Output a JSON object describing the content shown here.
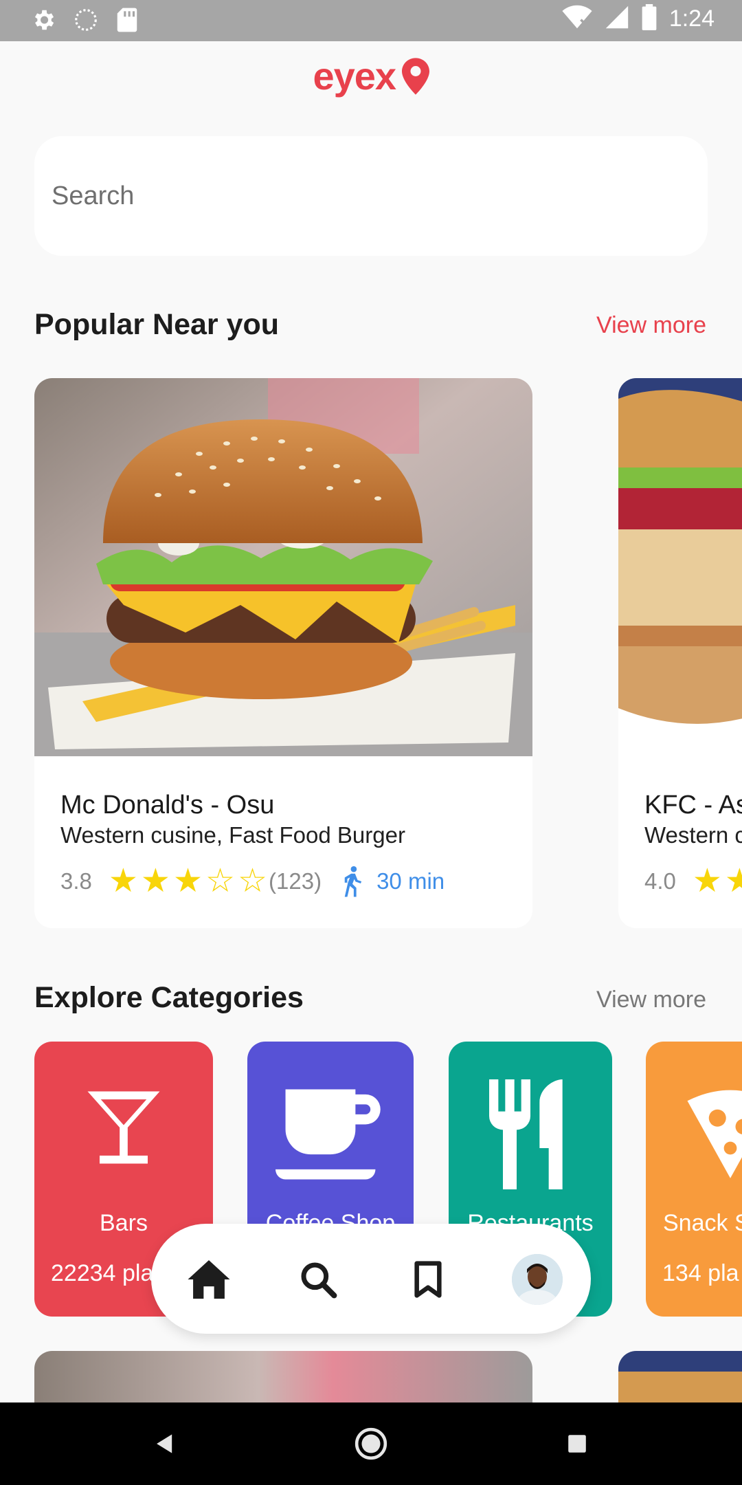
{
  "status_bar": {
    "time": "1:24",
    "icons": [
      "settings-icon",
      "sync-icon",
      "sd-card-icon",
      "wifi-icon",
      "signal-icon",
      "battery-icon"
    ]
  },
  "app": {
    "logo_text": "eyex",
    "brand_color": "#e8414c"
  },
  "search": {
    "placeholder": "Search"
  },
  "popular": {
    "title": "Popular Near you",
    "view_more": "View more",
    "cards": [
      {
        "name": "Mc Donald's - Osu",
        "description": "Western cusine, Fast Food Burger",
        "rating": "3.8",
        "stars_filled": 3,
        "stars_total": 5,
        "reviews": "(123)",
        "walk_time": "30 min",
        "image": "burger-photo"
      },
      {
        "name": "KFC - As",
        "description": "Western c",
        "rating": "4.0",
        "image": "sandwich-photo"
      }
    ]
  },
  "categories": {
    "title": "Explore Categories",
    "view_more": "View more",
    "items": [
      {
        "label": "Bars",
        "count": "22234 pla",
        "color": "#e84550",
        "icon": "cocktail-icon"
      },
      {
        "label": "Coffee Shop",
        "count": "",
        "color": "#5752d6",
        "icon": "coffee-cup-icon"
      },
      {
        "label": "Restaurants",
        "count": "",
        "color": "#0aa58f",
        "icon": "fork-knife-icon"
      },
      {
        "label": "Snack S",
        "count": "134 pla",
        "color": "#f89b3c",
        "icon": "pizza-icon"
      }
    ]
  },
  "bottom_nav": {
    "items": [
      "home-icon",
      "search-icon",
      "bookmark-icon",
      "profile-avatar"
    ]
  },
  "system_nav": {
    "items": [
      "back-icon",
      "home-circle-icon",
      "recents-icon"
    ]
  }
}
